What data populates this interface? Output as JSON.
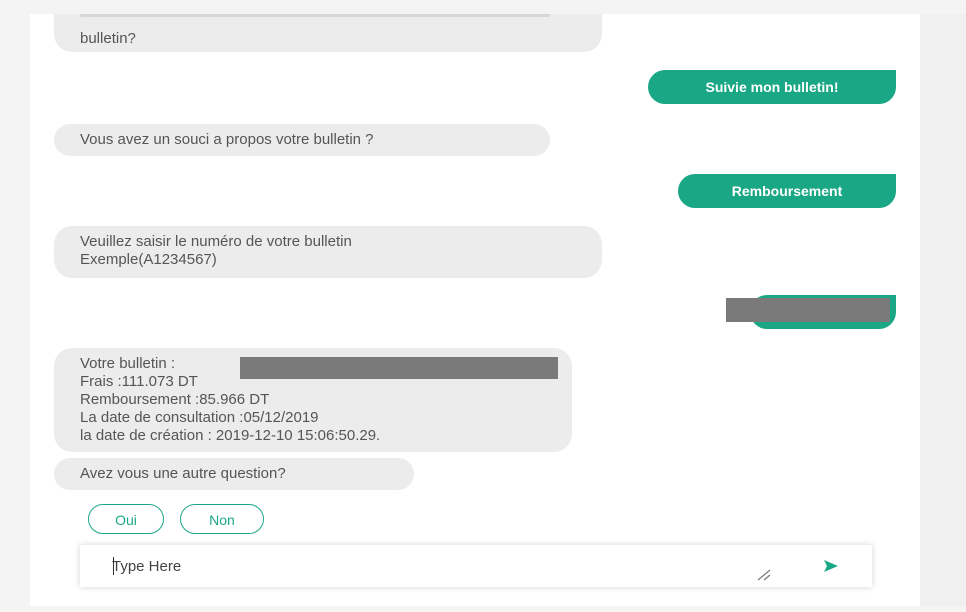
{
  "chat": {
    "partial_message_line2": "bulletin?",
    "user_msg_1": "Suivie mon bulletin!",
    "bot_msg_1": "Vous avez un souci a propos votre bulletin ?",
    "user_msg_2": "Remboursement",
    "bot_msg_2_line1": "Veuillez saisir le numéro de votre bulletin",
    "bot_msg_2_line2": "Exemple(A1234567)",
    "bot_msg_3": {
      "line1": "Votre bulletin :",
      "line2": "Frais :111.073   DT",
      "line3": "Remboursement :85.966  DT",
      "line4": "La date de consultation  :05/12/2019",
      "line5": "la date de création   : 2019-12-10 15:06:50.29."
    },
    "bot_msg_4": "Avez vous une autre question?"
  },
  "quick_replies": {
    "yes_label": "Oui",
    "no_label": "Non"
  },
  "composer": {
    "placeholder": "Type Here",
    "icons": [
      "resize-icon",
      "send-icon"
    ]
  },
  "colors": {
    "accent": "#1aa786",
    "bot_bubble": "#ececec",
    "redaction": "#7a7a7a"
  }
}
